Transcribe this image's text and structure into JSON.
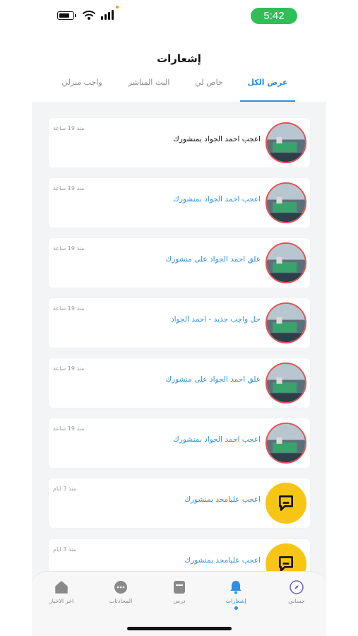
{
  "status": {
    "time": "5:42"
  },
  "header": {
    "title": "إشعارات",
    "tabs": [
      {
        "label": "عرض الكل",
        "active": true
      },
      {
        "label": "خاص لي",
        "active": false
      },
      {
        "label": "البث المباشر",
        "active": false
      },
      {
        "label": "واجب منزلي",
        "active": false
      }
    ]
  },
  "notifications": [
    {
      "text": "اعجب احمد الجواد بمنشورك",
      "time": "منذ 19 ساعة",
      "avatar": "ship-photo",
      "read": true
    },
    {
      "text": "اعجب احمد الجواد بمنشورك",
      "time": "منذ 19 ساعة",
      "avatar": "ship-photo",
      "read": false
    },
    {
      "text": "علق احمد الجواد على منشورك",
      "time": "منذ 19 ساعة",
      "avatar": "ship-photo",
      "read": false
    },
    {
      "text": "حل واجب جديد - احمد الجواد",
      "time": "منذ 19 ساعة",
      "avatar": "ship-photo",
      "read": false
    },
    {
      "text": "علق احمد الجواد على منشورك",
      "time": "منذ 19 ساعة",
      "avatar": "ship-photo",
      "read": false
    },
    {
      "text": "اعجب احمد الجواد بمنشورك",
      "time": "منذ 19 ساعة",
      "avatar": "ship-photo",
      "read": false
    },
    {
      "text": "اعجب علیامحد بمنشورك",
      "time": "منذ 3 ايام",
      "avatar": "yellow-logo",
      "read": false
    },
    {
      "text": "اعجب علیامحد بمنشورك",
      "time": "منذ 3 ايام",
      "avatar": "yellow-logo",
      "read": false
    }
  ],
  "nav": [
    {
      "label": "حسابي",
      "icon": "compass-icon",
      "active": false
    },
    {
      "label": "إشعارات",
      "icon": "bell-icon",
      "active": true
    },
    {
      "label": "درس",
      "icon": "lesson-icon",
      "active": false
    },
    {
      "label": "المحادثات",
      "icon": "chat-icon",
      "active": false
    },
    {
      "label": "اخر الاخبار",
      "icon": "home-icon",
      "active": false
    }
  ],
  "colors": {
    "accent": "#2f8fe0",
    "status_green": "#2fbf58",
    "avatar_ring": "#e25252",
    "logo_yellow": "#f7c615"
  }
}
